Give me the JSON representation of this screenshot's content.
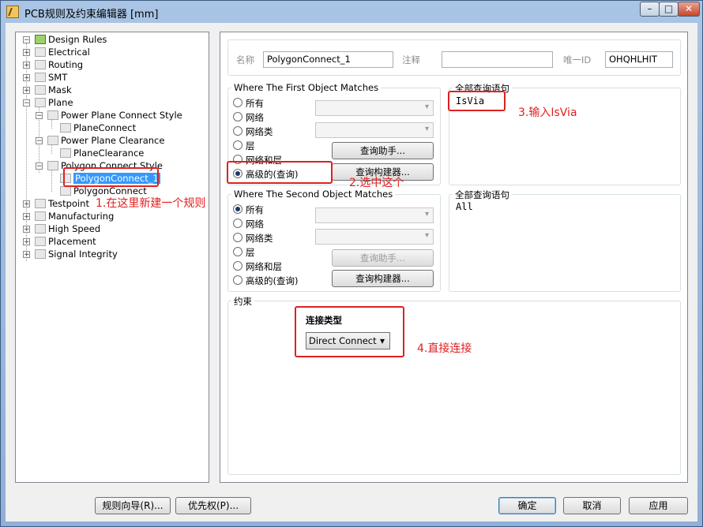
{
  "window": {
    "title": "PCB规则及约束编辑器 [mm]",
    "minimize": "–",
    "maximize": "□",
    "close": "✕"
  },
  "tree": {
    "root": "Design Rules",
    "items": [
      "Electrical",
      "Routing",
      "SMT",
      "Mask",
      "Plane"
    ],
    "plane_children": [
      "Power Plane Connect Style",
      "PlaneConnect",
      "Power Plane Clearance",
      "PlaneClearance",
      "Polygon Connect Style",
      "PolygonConnect_1",
      "PolygonConnect"
    ],
    "bottom_items": [
      "Testpoint",
      "Manufacturing",
      "High Speed",
      "Placement",
      "Signal Integrity"
    ]
  },
  "header": {
    "name_label": "名称",
    "name_value": "PolygonConnect_1",
    "comment_label": "注释",
    "comment_value": "",
    "id_label": "唯一ID",
    "id_value": "OHQHLHIT"
  },
  "first": {
    "title": "Where The First Object Matches",
    "options": [
      "所有",
      "网络",
      "网络类",
      "层",
      "网络和层",
      "高级的(查询)"
    ],
    "selected": 5,
    "helper_btn": "查询助手...",
    "builder_btn": "查询构建器...",
    "query_title": "全部查询语句",
    "query_text": "IsVia"
  },
  "second": {
    "title": "Where The Second Object Matches",
    "options": [
      "所有",
      "网络",
      "网络类",
      "层",
      "网络和层",
      "高级的(查询)"
    ],
    "selected": 0,
    "helper_btn": "查询助手...",
    "builder_btn": "查询构建器...",
    "query_title": "全部查询语句",
    "query_text": "All"
  },
  "constraint": {
    "title": "约束",
    "conn_label": "连接类型",
    "conn_value": "Direct Connect"
  },
  "annotations": {
    "a1": "1.在这里新建一个规则",
    "a2": "2.选中这个",
    "a3": "3.输入IsVia",
    "a4": "4.直接连接"
  },
  "footer": {
    "wizard": "规则向导(R)...",
    "priority": "优先权(P)...",
    "ok": "确定",
    "cancel": "取消",
    "apply": "应用"
  },
  "colors": {
    "annotation": "#e02020",
    "selection": "#3399ff"
  }
}
